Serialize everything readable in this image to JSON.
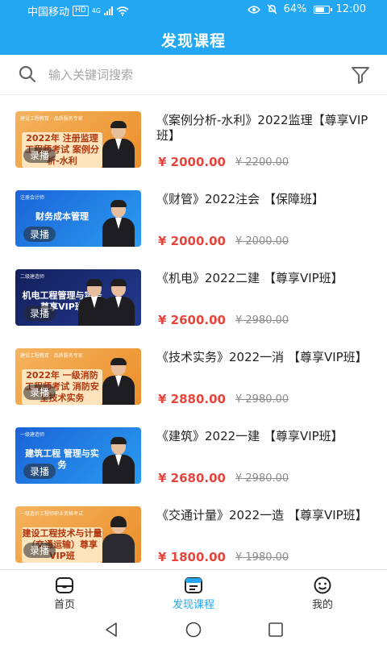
{
  "status_bar": {
    "carrier": "中国移动",
    "hd": "HD",
    "network": "4G",
    "battery": "64%",
    "time": "12:00"
  },
  "header": {
    "title": "发现课程"
  },
  "search": {
    "placeholder": "输入关键词搜索",
    "value": ""
  },
  "courses": [
    {
      "thumb_top": "建设工程教育 · 品质服务专家",
      "thumb_title": "2022年 注册监理工程师考试 案例分析-水利",
      "tag": "录播",
      "title": "《案例分析-水利》2022监理【尊享VIP班】",
      "price": "¥ 2000.00",
      "old_price": "¥ 2200.00"
    },
    {
      "thumb_top": "注册会计师",
      "thumb_title": "财务成本管理",
      "tag": "录播",
      "title": "《财管》2022注会 【保障班】",
      "price": "¥ 2000.00",
      "old_price": "¥ 2000.00"
    },
    {
      "thumb_top": "二级建造师",
      "thumb_title": "机电工程管理与实务 尊享VIP班",
      "tag": "录播",
      "title": "《机电》2022二建 【尊享VIP班】",
      "price": "¥ 2600.00",
      "old_price": "¥ 2980.00"
    },
    {
      "thumb_top": "建设工程教育 · 品质服务专家",
      "thumb_title": "2022年 一级消防工程师考试 消防安全技术实务",
      "tag": "录播",
      "title": "《技术实务》2022一消 【尊享VIP班】",
      "price": "¥ 2880.00",
      "old_price": "¥ 2980.00"
    },
    {
      "thumb_top": "一级建造师",
      "thumb_title": "建筑工程 管理与实务",
      "tag": "录播",
      "title": "《建筑》2022一建 【尊享VIP班】",
      "price": "¥ 2680.00",
      "old_price": "¥ 2980.00"
    },
    {
      "thumb_top": "一级造价工程师职业资格考试",
      "thumb_title": "建设工程技术与计量（交通运输）尊享VIP班",
      "tag": "录播",
      "title": "《交通计量》2022一造 【尊享VIP班】",
      "price": "¥ 1800.00",
      "old_price": "¥ 1980.00"
    }
  ],
  "bottom_nav": {
    "home": "首页",
    "discover": "发现课程",
    "mine": "我的"
  },
  "colors": {
    "primary": "#23a7f2",
    "price": "#e7443c"
  }
}
